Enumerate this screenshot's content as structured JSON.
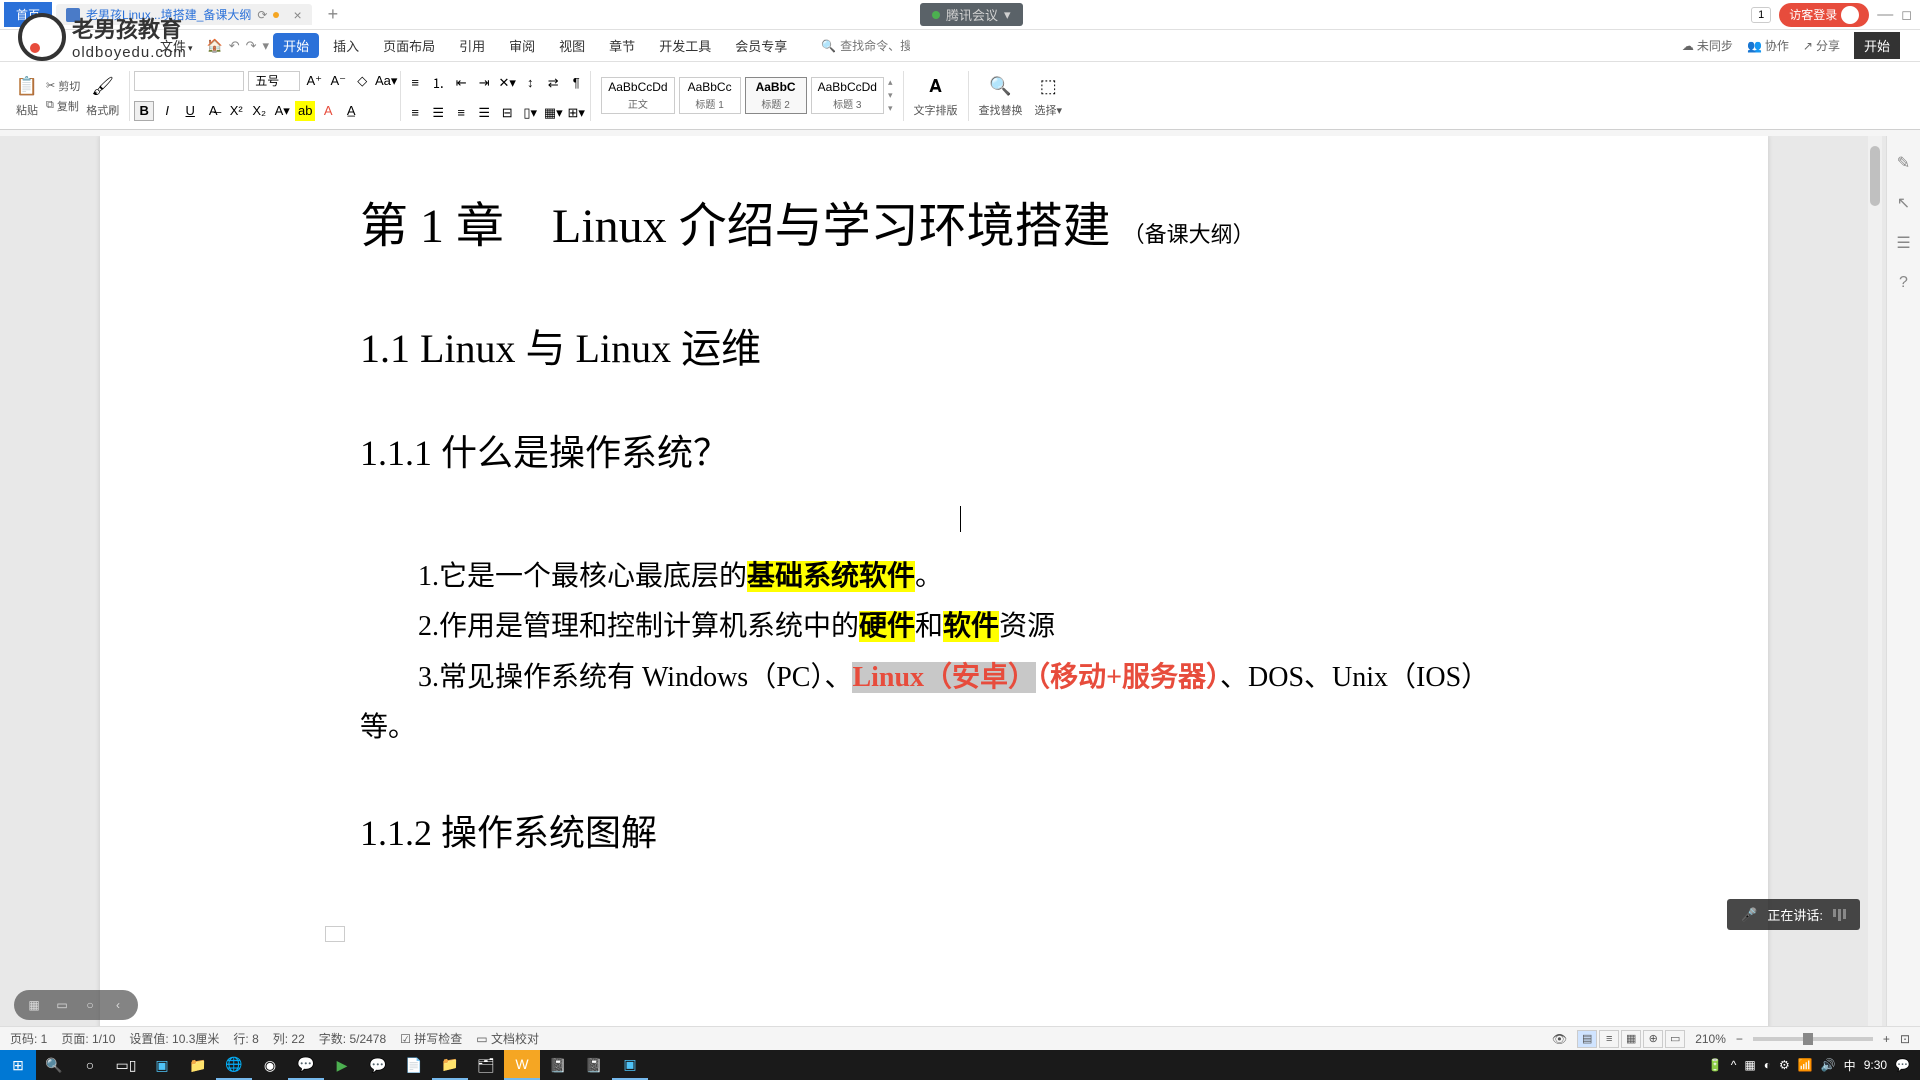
{
  "meeting": {
    "label": "腾讯会议"
  },
  "logo": {
    "cn": "老男孩教育",
    "en": "oldboyedu.com"
  },
  "titlebar": {
    "home": "首页",
    "doc_title": "老男孩Linux...境搭建_备课大纲",
    "count": "1",
    "login": "访客登录"
  },
  "ribbon": {
    "tabs": [
      "文件",
      "开始",
      "插入",
      "页面布局",
      "引用",
      "审阅",
      "视图",
      "章节",
      "开发工具",
      "会员专享"
    ],
    "search_placeholder": "查找命令、搜索模板",
    "sync": "未同步",
    "collab": "协作",
    "share": "分享",
    "start": "开始"
  },
  "toolbar": {
    "paste": "粘贴",
    "cut": "剪切",
    "copy": "复制",
    "format_painter": "格式刷",
    "font_size_label": "五号",
    "styles": [
      {
        "preview": "AaBbCcDd",
        "name": "正文"
      },
      {
        "preview": "AaBbCc",
        "name": "标题 1"
      },
      {
        "preview": "AaBbC",
        "name": "标题 2"
      },
      {
        "preview": "AaBbCcDd",
        "name": "标题 3"
      }
    ],
    "text_layout": "文字排版",
    "find_replace": "查找替换",
    "select": "选择"
  },
  "document": {
    "h1_pre": "第 1 章　Linux 介绍与学习环境搭建",
    "h1_note": "（备课大纲）",
    "h2": "1.1 Linux 与 Linux 运维",
    "h3_1": "1.1.1 什么是操作系统？",
    "line1_pre": "1.它是一个最核心最底层的",
    "line1_hl": "基础系统软件",
    "line1_post": "。",
    "line2_pre": "2.作用是管理和控制计算机系统中的",
    "line2_hl1": "硬件",
    "line2_mid": "和",
    "line2_hl2": "软件",
    "line2_post": "资源",
    "line3_pre": "3.常见操作系统有 Windows（PC）、",
    "line3_redsel": "Linux（安卓）",
    "line3_red": "（移动+服务器）",
    "line3_post": "、DOS、Unix（IOS）",
    "line3_wrap": "等。",
    "h3_2": "1.1.2 操作系统图解"
  },
  "speaking": {
    "label": "正在讲话:"
  },
  "status": {
    "page_label": "页码: 1",
    "page_count": "页面: 1/10",
    "set_value": "设置值: 10.3厘米",
    "row": "行: 8",
    "col": "列: 22",
    "words": "字数: 5/2478",
    "spell": "拼写检查",
    "proof": "文档校对",
    "zoom": "210%"
  },
  "taskbar": {
    "time": "9:30"
  }
}
